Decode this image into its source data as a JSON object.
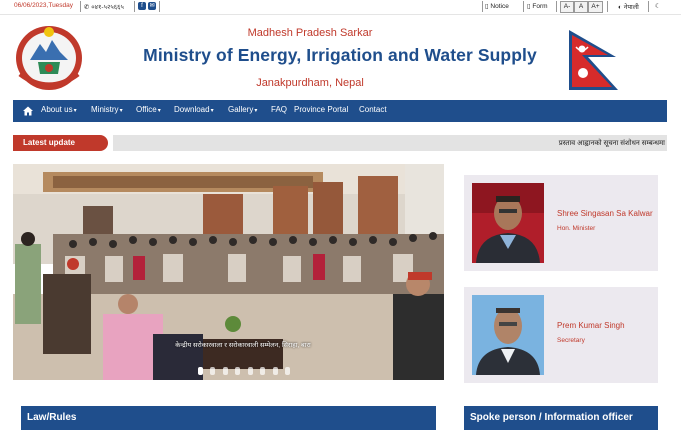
{
  "topbar": {
    "date": "06/06/2023,Tuesday",
    "phone": "०४१-५२५६६५",
    "notice": "Notice",
    "form": "Form",
    "font_minus": "A-",
    "font_normal": "A",
    "font_plus": "A+",
    "language": "नेपाली",
    "dark_mode": "☾"
  },
  "header": {
    "subtitle": "Madhesh Pradesh Sarkar",
    "title": "Ministry of Energy, Irrigation and Water Supply",
    "location": "Janakpurdham, Nepal"
  },
  "nav": {
    "items": [
      {
        "label": "About us",
        "dropdown": true
      },
      {
        "label": "Ministry",
        "dropdown": true
      },
      {
        "label": "Office",
        "dropdown": true
      },
      {
        "label": "Download",
        "dropdown": true
      },
      {
        "label": "Gallery",
        "dropdown": true
      },
      {
        "label": "FAQ",
        "dropdown": false
      },
      {
        "label": "Province Portal",
        "dropdown": false
      },
      {
        "label": "Contact",
        "dropdown": false
      }
    ]
  },
  "latest_update": {
    "label": "Latest update",
    "ticker": "प्रस्ताव आह्वानको सूचना संशोधन सम्बन्धमा"
  },
  "slider": {
    "caption": "केन्द्रीय सरोकारवाला र सरोकारवाली सम्मेलन, सिराहा, बारा",
    "slide_count": 8,
    "active_slide": 1
  },
  "officials": [
    {
      "name": "Shree Singasan Sa Kalwar",
      "role": "Hon. Minister"
    },
    {
      "name": "Prem Kumar Singh",
      "role": "Secretary"
    }
  ],
  "sections": {
    "law": "Law/Rules",
    "spokesperson": "Spoke person / Information officer"
  },
  "colors": {
    "primary": "#1f4e8c",
    "accent": "#c0392b",
    "card_bg": "#ece9ef"
  }
}
